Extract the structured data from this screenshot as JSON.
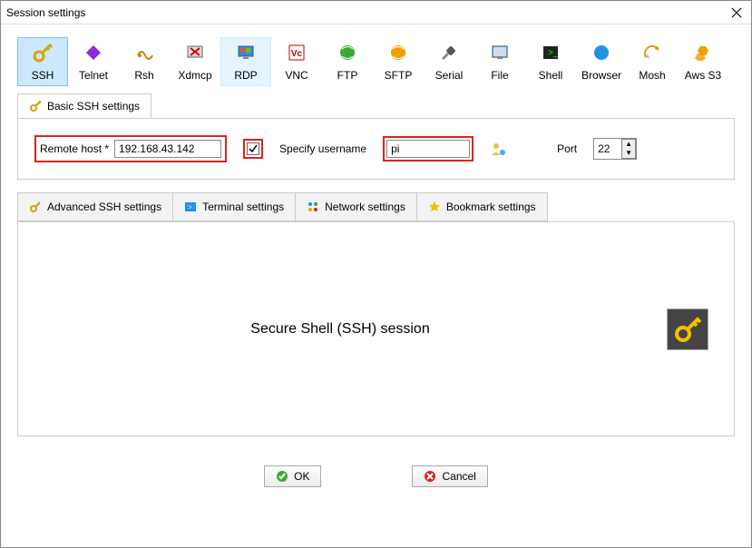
{
  "window": {
    "title": "Session settings"
  },
  "protocols": [
    {
      "label": "SSH",
      "icon": "key-icon"
    },
    {
      "label": "Telnet",
      "icon": "diamond-icon"
    },
    {
      "label": "Rsh",
      "icon": "wave-icon"
    },
    {
      "label": "Xdmcp",
      "icon": "x-icon"
    },
    {
      "label": "RDP",
      "icon": "monitor-icon"
    },
    {
      "label": "VNC",
      "icon": "vnc-icon"
    },
    {
      "label": "FTP",
      "icon": "globe-icon"
    },
    {
      "label": "SFTP",
      "icon": "globe2-icon"
    },
    {
      "label": "Serial",
      "icon": "plug-icon"
    },
    {
      "label": "File",
      "icon": "file-icon"
    },
    {
      "label": "Shell",
      "icon": "terminal-icon"
    },
    {
      "label": "Browser",
      "icon": "world-icon"
    },
    {
      "label": "Mosh",
      "icon": "dish-icon"
    },
    {
      "label": "Aws S3",
      "icon": "hex-icon"
    }
  ],
  "basic": {
    "tab_label": "Basic SSH settings",
    "remote_host_label": "Remote host *",
    "remote_host_value": "192.168.43.142",
    "specify_username_label": "Specify username",
    "specify_username_checked": true,
    "username_value": "pi",
    "port_label": "Port",
    "port_value": "22"
  },
  "adv_tabs": [
    {
      "label": "Advanced SSH settings",
      "icon": "key-icon"
    },
    {
      "label": "Terminal settings",
      "icon": "terminal2-icon"
    },
    {
      "label": "Network settings",
      "icon": "network-icon"
    },
    {
      "label": "Bookmark settings",
      "icon": "star-icon"
    }
  ],
  "session_description": "Secure Shell (SSH) session",
  "buttons": {
    "ok": "OK",
    "cancel": "Cancel"
  }
}
